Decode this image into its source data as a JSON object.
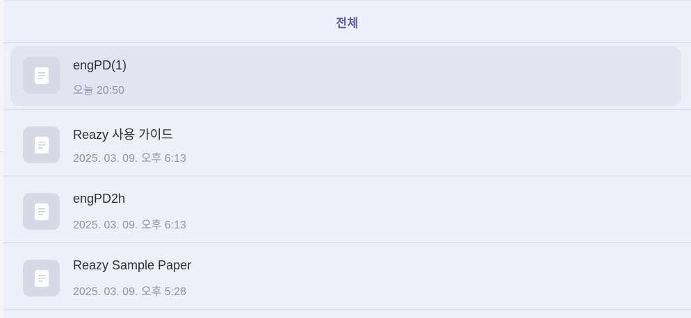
{
  "header": {
    "title": "전체"
  },
  "files": [
    {
      "name": "engPD(1)",
      "date": "오늘 20:50",
      "selected": true
    },
    {
      "name": "Reazy 사용 가이드",
      "date": "2025. 03. 09. 오후 6:13",
      "selected": false
    },
    {
      "name": "engPD2h",
      "date": "2025. 03. 09. 오후 6:13",
      "selected": false
    },
    {
      "name": "Reazy Sample Paper",
      "date": "2025. 03. 09. 오후 5:28",
      "selected": false
    }
  ],
  "icons": {
    "file": "document-icon"
  },
  "colors": {
    "background": "#eeeff8",
    "header_title": "#5b5a9a",
    "selected_row": "#e2e4f1",
    "thumbnail": "#d7d9e6"
  }
}
